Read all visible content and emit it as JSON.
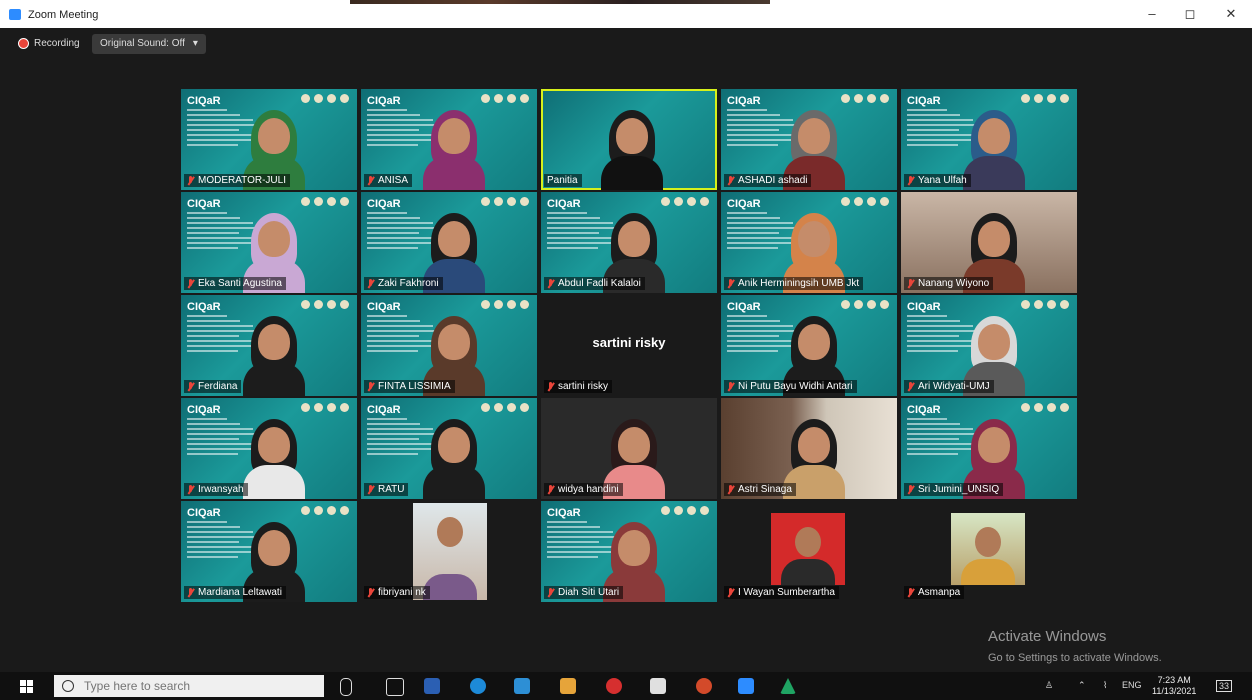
{
  "window": {
    "title": "Zoom Meeting",
    "minimize": "–",
    "maximize": "◻",
    "close": "✕"
  },
  "toolbar": {
    "recording_label": "Recording",
    "sound_label": "Original Sound: Off",
    "sound_caret": "▾"
  },
  "tiles": [
    {
      "name": "MODERATOR-JULI",
      "kind": "slide",
      "hijab": "#2e7d3e",
      "body": "#2e7d3e"
    },
    {
      "name": "ANISA",
      "kind": "slide",
      "hijab": "#8b2f6e",
      "body": "#8b2f6e"
    },
    {
      "name": "Panitia",
      "kind": "active",
      "hijab": "#1c1c1c",
      "body": "#111"
    },
    {
      "name": "ASHADI ashadi",
      "kind": "slide",
      "hijab": "#6a6a6a",
      "body": "#7a2a2a"
    },
    {
      "name": "Yana Ulfah",
      "kind": "slide",
      "hijab": "#2b5c8a",
      "body": "#3a3a5a"
    },
    {
      "name": "Eka Santi Agustina",
      "kind": "slide",
      "hijab": "#c9a8d4",
      "body": "#c9a8d4"
    },
    {
      "name": "Zaki Fakhroni",
      "kind": "slide",
      "hijab": "#1c1c1c",
      "body": "#2a4a7a"
    },
    {
      "name": "Abdul Fadli Kalaloi",
      "kind": "slide",
      "hijab": "#1c1c1c",
      "body": "#2a2a2a"
    },
    {
      "name": "Anik Herminingsih UMB Jkt",
      "kind": "slide",
      "hijab": "#d4834a",
      "body": "#d4834a"
    },
    {
      "name": "Nanang Wiyono",
      "kind": "room",
      "hijab": "#1c1c1c",
      "body": "#7a3a2a"
    },
    {
      "name": "Ferdiana",
      "kind": "slide",
      "hijab": "#1c1c1c",
      "body": "#1c1c1c"
    },
    {
      "name": "FINTA LISSIMIA",
      "kind": "slide",
      "hijab": "#5a3a2a",
      "body": "#5a3a2a"
    },
    {
      "name": "sartini risky",
      "kind": "dark",
      "center": "sartini risky"
    },
    {
      "name": "Ni Putu Bayu Widhi Antari",
      "kind": "slide",
      "hijab": "#1c1c1c",
      "body": "#1c1c1c"
    },
    {
      "name": "Ari Widyati-UMJ",
      "kind": "slide",
      "hijab": "#d8d8d8",
      "body": "#5a5a5a"
    },
    {
      "name": "Irwansyah",
      "kind": "slide",
      "hijab": "#1c1c1c",
      "body": "#e8e8e8"
    },
    {
      "name": "RATU",
      "kind": "slide",
      "hijab": "#1c1c1c",
      "body": "#1c1c1c"
    },
    {
      "name": "widya handini",
      "kind": "dim",
      "hijab": "#2a1a1a",
      "body": "#e88a8a"
    },
    {
      "name": "Astri Sinaga",
      "kind": "office",
      "hijab": "#1c1c1c",
      "body": "#c9a06a"
    },
    {
      "name": "Sri Jumini_UNSIQ",
      "kind": "slide",
      "hijab": "#8a2a4a",
      "body": "#8a2a4a"
    },
    {
      "name": "Mardiana Leltawati",
      "kind": "slide",
      "hijab": "#1c1c1c",
      "body": "#1c1c1c"
    },
    {
      "name": "fibriyani nk",
      "kind": "dark",
      "photo": "fibri"
    },
    {
      "name": "Diah Siti Utari",
      "kind": "slide",
      "hijab": "#8a3a3a",
      "body": "#8a3a3a"
    },
    {
      "name": "I Wayan Sumberartha",
      "kind": "dark",
      "photo": "wayan"
    },
    {
      "name": "Asmanpa",
      "kind": "dark",
      "photo": "asman"
    }
  ],
  "slide": {
    "title": "CIQaR"
  },
  "watermark": {
    "line1": "Activate Windows",
    "line2": "Go to Settings to activate Windows."
  },
  "taskbar": {
    "search_placeholder": "Type here to search",
    "lang": "ENG",
    "time": "7:23 AM",
    "date": "11/13/2021",
    "notifications": "33"
  }
}
